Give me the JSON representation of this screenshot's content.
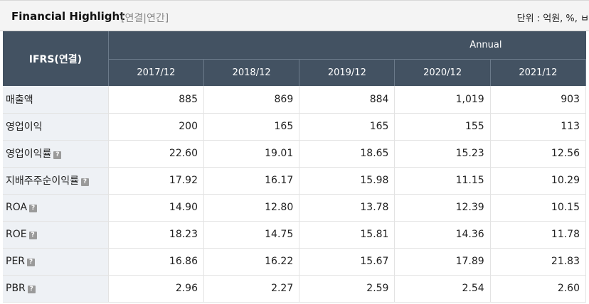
{
  "header": {
    "title": "Financial Highlight",
    "tabs": [
      "[연결|",
      "연간]"
    ],
    "unit": "단위 : 억원, %, ㅂ"
  },
  "table": {
    "corner": "IFRS(연결)",
    "group": "Annual",
    "years": [
      "2017/12",
      "2018/12",
      "2019/12",
      "2020/12",
      "2021/12"
    ],
    "rows": [
      {
        "label": "매출액",
        "help": false,
        "values": [
          "885",
          "869",
          "884",
          "1,019",
          "903"
        ]
      },
      {
        "label": "영업이익",
        "help": false,
        "values": [
          "200",
          "165",
          "165",
          "155",
          "113"
        ]
      },
      {
        "label": "영업이익률",
        "help": true,
        "values": [
          "22.60",
          "19.01",
          "18.65",
          "15.23",
          "12.56"
        ]
      },
      {
        "label": "지배주주순이익률",
        "help": true,
        "values": [
          "17.92",
          "16.17",
          "15.98",
          "11.15",
          "10.29"
        ]
      },
      {
        "label": "ROA",
        "help": true,
        "values": [
          "14.90",
          "12.80",
          "13.78",
          "12.39",
          "10.15"
        ]
      },
      {
        "label": "ROE",
        "help": true,
        "values": [
          "18.23",
          "14.75",
          "15.81",
          "14.36",
          "11.78"
        ]
      },
      {
        "label": "PER",
        "help": true,
        "values": [
          "16.86",
          "16.22",
          "15.67",
          "17.89",
          "21.83"
        ]
      },
      {
        "label": "PBR",
        "help": true,
        "values": [
          "2.96",
          "2.27",
          "2.59",
          "2.54",
          "2.60"
        ]
      }
    ],
    "help_glyph": "?"
  },
  "colors": {
    "header_bg": "#435262",
    "label_bg": "#eef1f5",
    "topbar_bg": "#f4f4f4"
  }
}
